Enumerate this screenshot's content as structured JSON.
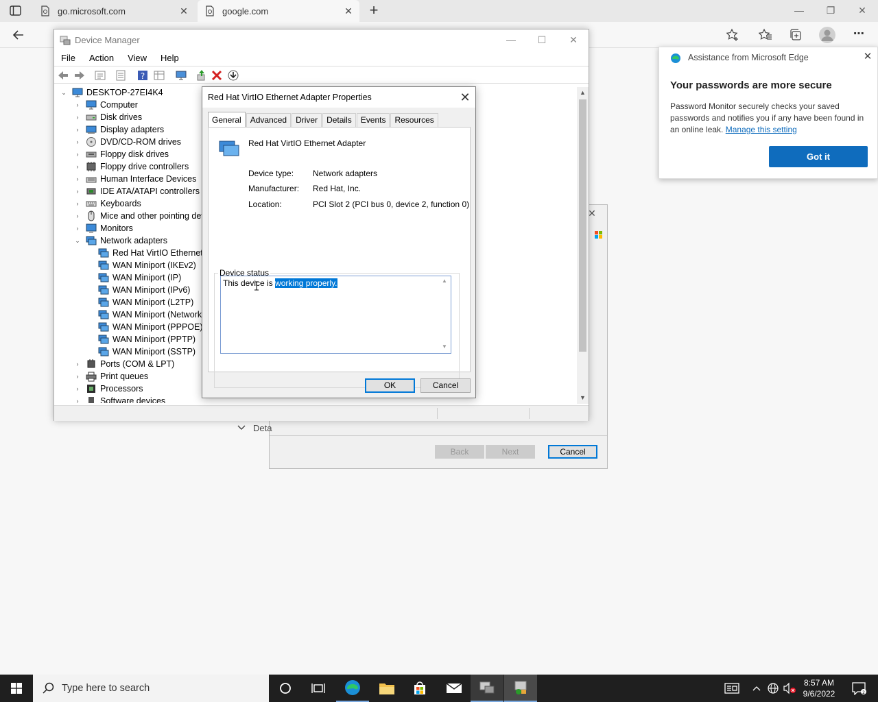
{
  "browser": {
    "tabs": [
      {
        "label": "go.microsoft.com"
      },
      {
        "label": "google.com"
      }
    ],
    "new_tab_glyph": "+",
    "close_glyph": "✕"
  },
  "device_manager": {
    "title": "Device Manager",
    "menu": [
      "File",
      "Action",
      "View",
      "Help"
    ],
    "tree": {
      "root": "DESKTOP-27EI4K4",
      "categories": [
        "Computer",
        "Disk drives",
        "Display adapters",
        "DVD/CD-ROM drives",
        "Floppy disk drives",
        "Floppy drive controllers",
        "Human Interface Devices",
        "IDE ATA/ATAPI controllers",
        "Keyboards",
        "Mice and other pointing devi",
        "Monitors",
        "Network adapters"
      ],
      "network_children": [
        "Red Hat VirtIO Ethernet A",
        "WAN Miniport (IKEv2)",
        "WAN Miniport (IP)",
        "WAN Miniport (IPv6)",
        "WAN Miniport (L2TP)",
        "WAN Miniport (Network",
        "WAN Miniport (PPPOE)",
        "WAN Miniport (PPTP)",
        "WAN Miniport (SSTP)"
      ],
      "after": [
        "Ports (COM & LPT)",
        "Print queues",
        "Processors",
        "Software devices"
      ]
    }
  },
  "wizard": {
    "details_label": "Deta",
    "back_label": "Back",
    "next_label": "Next",
    "cancel_label": "Cancel"
  },
  "properties": {
    "title": "Red Hat VirtIO Ethernet Adapter Properties",
    "tabs": [
      "General",
      "Advanced",
      "Driver",
      "Details",
      "Events",
      "Resources"
    ],
    "device_name": "Red Hat VirtIO Ethernet Adapter",
    "fields": [
      {
        "label": "Device type:",
        "value": "Network adapters"
      },
      {
        "label": "Manufacturer:",
        "value": "Red Hat, Inc."
      },
      {
        "label": "Location:",
        "value": "PCI Slot 2 (PCI bus 0, device 2, function 0)"
      }
    ],
    "status_legend": "Device status",
    "status_text_plain": "This device is ",
    "status_text_selected": "working properly.",
    "ok_label": "OK",
    "cancel_label": "Cancel"
  },
  "edge_popup": {
    "header": "Assistance from Microsoft Edge",
    "heading": "Your passwords are more secure",
    "body": "Password Monitor securely checks your saved passwords and notifies you if any have been found in an online leak.",
    "link": "Manage this setting",
    "button": "Got it"
  },
  "taskbar": {
    "search_placeholder": "Type here to search",
    "time": "8:57 AM",
    "date": "9/6/2022"
  },
  "colors": {
    "accent": "#0078d7",
    "edge_button": "#0f6cbd",
    "taskbar": "#1f1f1f"
  }
}
